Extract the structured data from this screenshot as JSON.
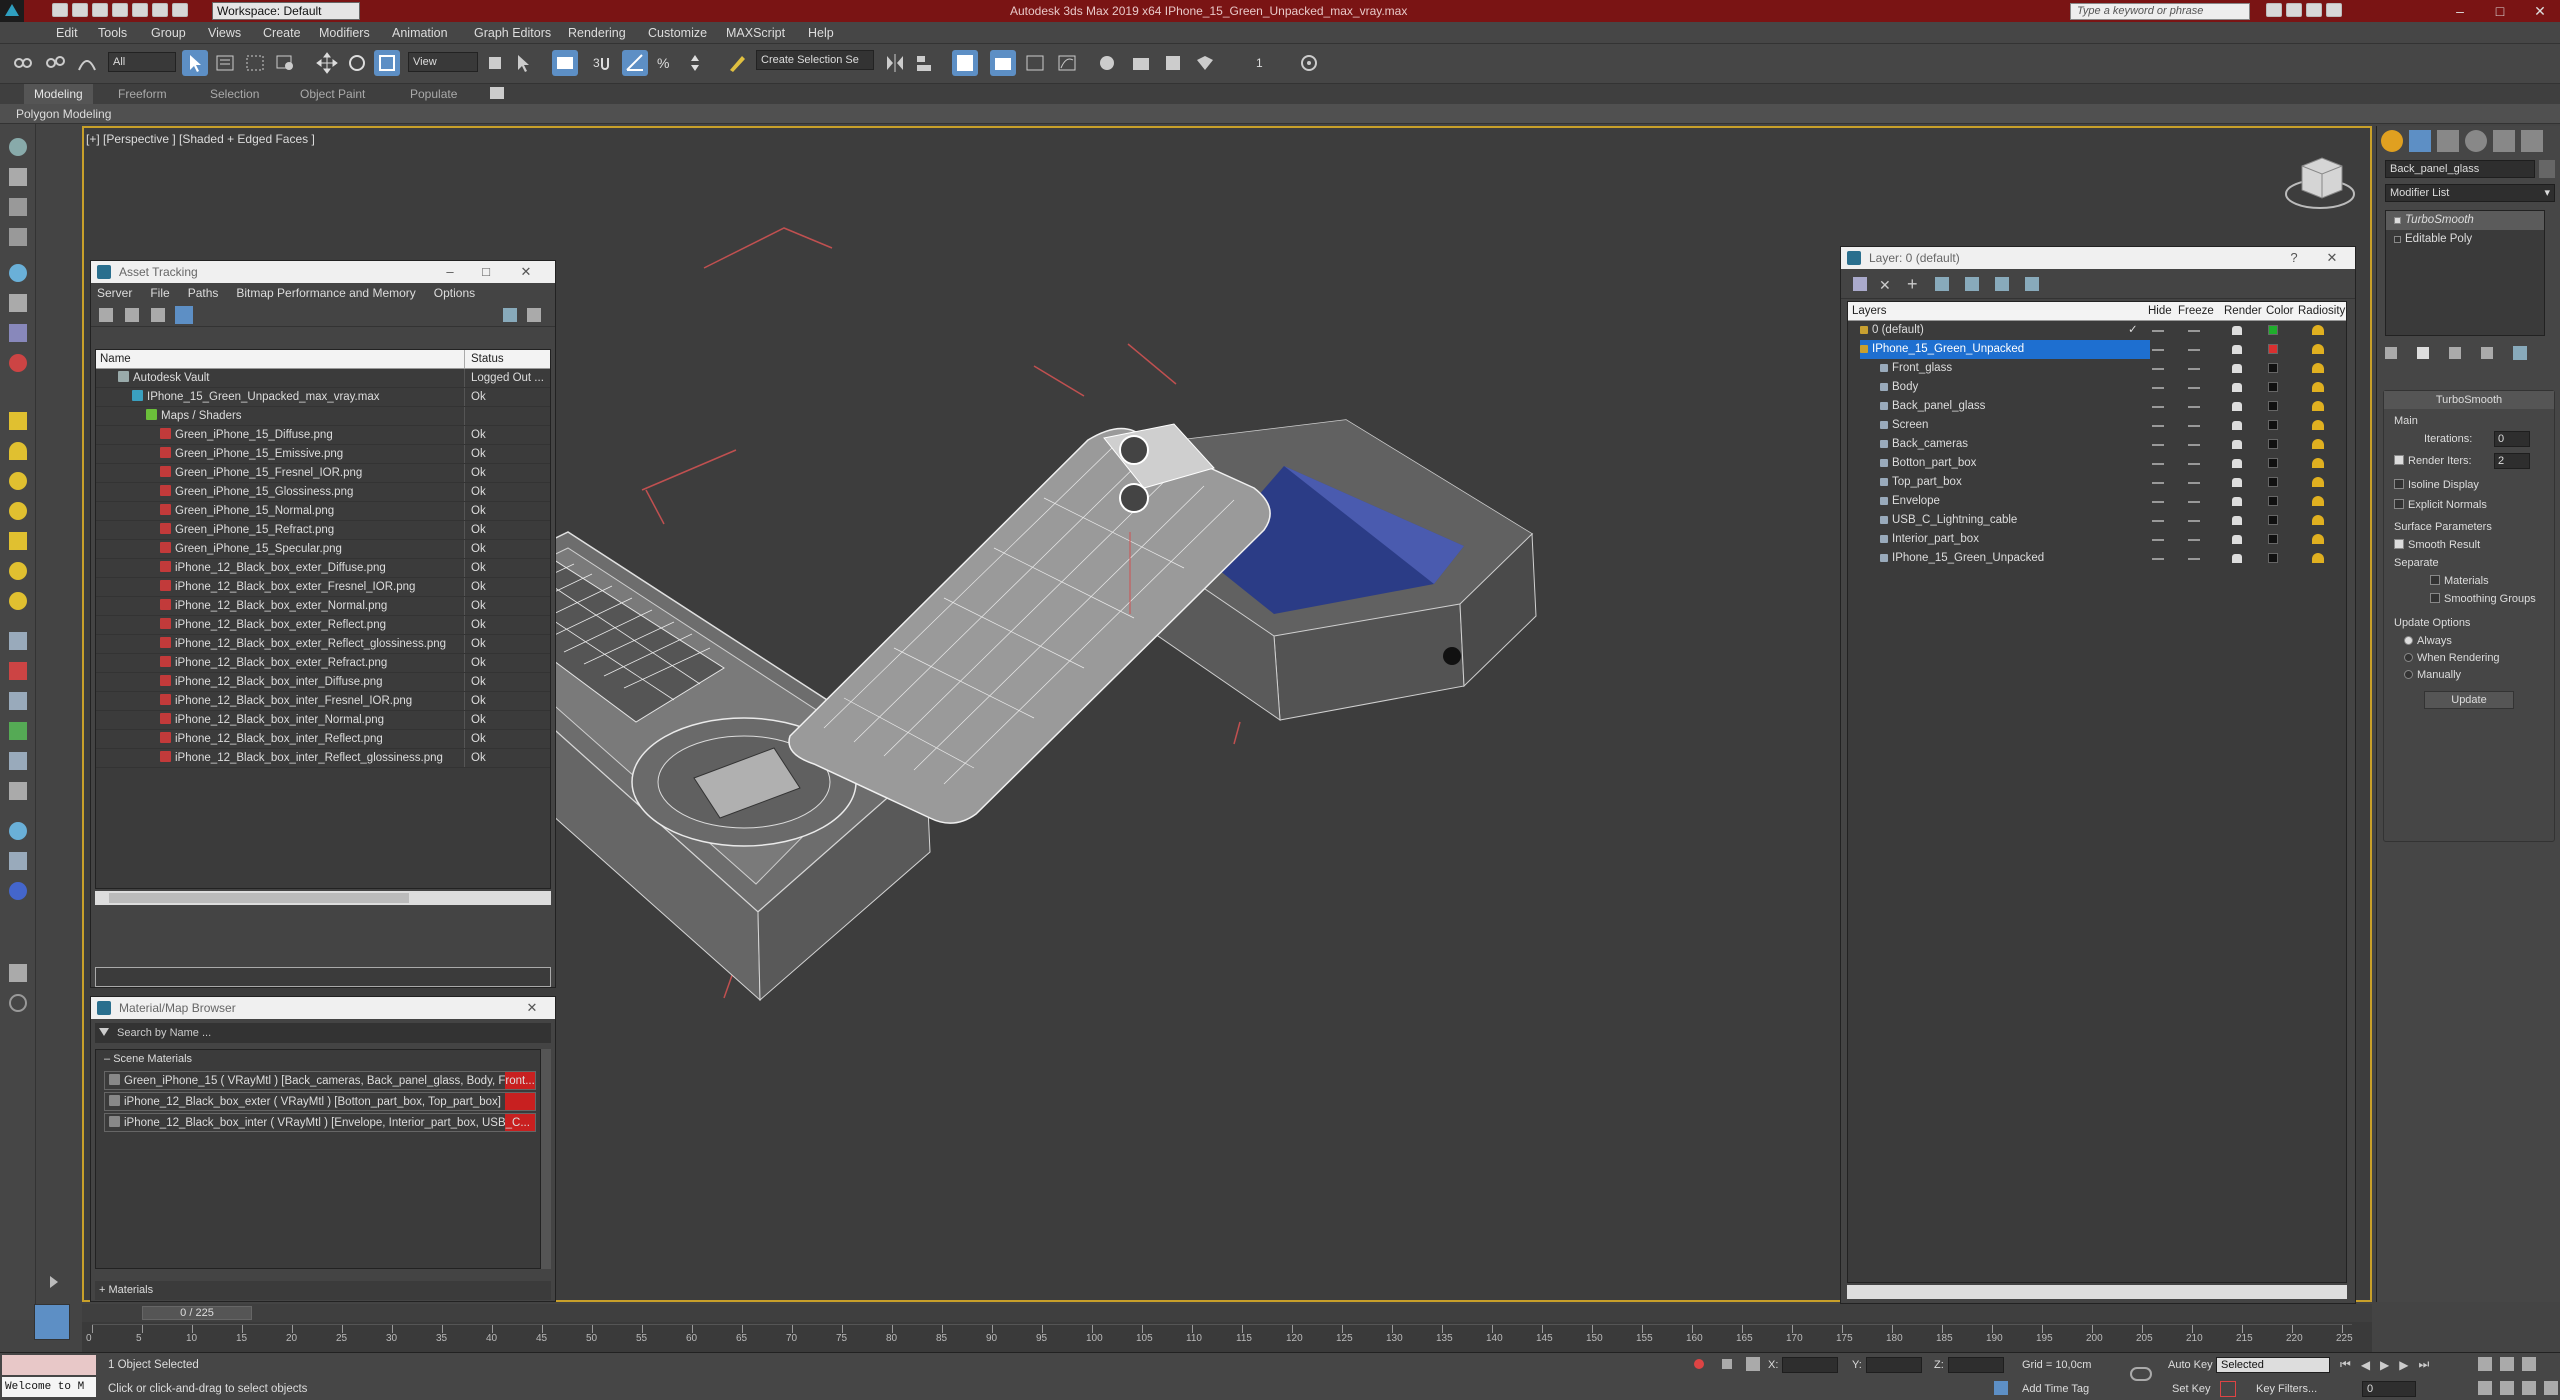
{
  "app": {
    "title": "Autodesk 3ds Max  2019 x64      IPhone_15_Green_Unpacked_max_vray.max",
    "workspace": "Workspace: Default",
    "search_placeholder": "Type a keyword or phrase"
  },
  "menu": [
    "Edit",
    "Tools",
    "Group",
    "Views",
    "Create",
    "Modifiers",
    "Animation",
    "Graph Editors",
    "Rendering",
    "Customize",
    "MAXScript",
    "Help"
  ],
  "toolbar": {
    "selection_filter": "All",
    "ref_coord": "View",
    "named_selection": "Create Selection Se",
    "snap_label": "3",
    "spinner_value": "1"
  },
  "ribbon": {
    "tabs": [
      "Modeling",
      "Freeform",
      "Selection",
      "Object Paint",
      "Populate"
    ],
    "active": "Modeling",
    "subtitle": "Polygon Modeling"
  },
  "viewport": {
    "label": "[+] [Perspective ] [Shaded + Edged Faces ]"
  },
  "asset_tracking": {
    "title": "Asset Tracking",
    "menu": [
      "Server",
      "File",
      "Paths",
      "Bitmap Performance and Memory",
      "Options"
    ],
    "col_name": "Name",
    "col_status": "Status",
    "rows": [
      {
        "name": "Autodesk Vault",
        "status": "Logged Out ...",
        "indent": 1,
        "icon": "vault"
      },
      {
        "name": "IPhone_15_Green_Unpacked_max_vray.max",
        "status": "Ok",
        "indent": 2,
        "icon": "max"
      },
      {
        "name": "Maps / Shaders",
        "status": "",
        "indent": 3,
        "icon": "maps"
      },
      {
        "name": "Green_iPhone_15_Diffuse.png",
        "status": "Ok",
        "indent": 4,
        "icon": "png"
      },
      {
        "name": "Green_iPhone_15_Emissive.png",
        "status": "Ok",
        "indent": 4,
        "icon": "png"
      },
      {
        "name": "Green_iPhone_15_Fresnel_IOR.png",
        "status": "Ok",
        "indent": 4,
        "icon": "png"
      },
      {
        "name": "Green_iPhone_15_Glossiness.png",
        "status": "Ok",
        "indent": 4,
        "icon": "png"
      },
      {
        "name": "Green_iPhone_15_Normal.png",
        "status": "Ok",
        "indent": 4,
        "icon": "png"
      },
      {
        "name": "Green_iPhone_15_Refract.png",
        "status": "Ok",
        "indent": 4,
        "icon": "png"
      },
      {
        "name": "Green_iPhone_15_Specular.png",
        "status": "Ok",
        "indent": 4,
        "icon": "png"
      },
      {
        "name": "iPhone_12_Black_box_exter_Diffuse.png",
        "status": "Ok",
        "indent": 4,
        "icon": "png"
      },
      {
        "name": "iPhone_12_Black_box_exter_Fresnel_IOR.png",
        "status": "Ok",
        "indent": 4,
        "icon": "png"
      },
      {
        "name": "iPhone_12_Black_box_exter_Normal.png",
        "status": "Ok",
        "indent": 4,
        "icon": "png"
      },
      {
        "name": "iPhone_12_Black_box_exter_Reflect.png",
        "status": "Ok",
        "indent": 4,
        "icon": "png"
      },
      {
        "name": "iPhone_12_Black_box_exter_Reflect_glossiness.png",
        "status": "Ok",
        "indent": 4,
        "icon": "png"
      },
      {
        "name": "iPhone_12_Black_box_exter_Refract.png",
        "status": "Ok",
        "indent": 4,
        "icon": "png"
      },
      {
        "name": "iPhone_12_Black_box_inter_Diffuse.png",
        "status": "Ok",
        "indent": 4,
        "icon": "png"
      },
      {
        "name": "iPhone_12_Black_box_inter_Fresnel_IOR.png",
        "status": "Ok",
        "indent": 4,
        "icon": "png"
      },
      {
        "name": "iPhone_12_Black_box_inter_Normal.png",
        "status": "Ok",
        "indent": 4,
        "icon": "png"
      },
      {
        "name": "iPhone_12_Black_box_inter_Reflect.png",
        "status": "Ok",
        "indent": 4,
        "icon": "png"
      },
      {
        "name": "iPhone_12_Black_box_inter_Reflect_glossiness.png",
        "status": "Ok",
        "indent": 4,
        "icon": "png"
      }
    ]
  },
  "material_browser": {
    "title": "Material/Map Browser",
    "search_placeholder": "Search by Name ...",
    "section": "Scene Materials",
    "items": [
      "Green_iPhone_15 ( VRayMtl ) [Back_cameras, Back_panel_glass, Body, Front...",
      "iPhone_12_Black_box_exter ( VRayMtl ) [Botton_part_box, Top_part_box]",
      "iPhone_12_Black_box_inter ( VRayMtl ) [Envelope, Interior_part_box, USB_C..."
    ],
    "footer": "+ Materials"
  },
  "layer_explorer": {
    "title": "Layer: 0 (default)",
    "columns": [
      "Layers",
      "Hide",
      "Freeze",
      "Render",
      "Color",
      "Radiosity"
    ],
    "rows": [
      {
        "name": "0 (default)",
        "level": 0,
        "color": "#1fae2c",
        "selected": false,
        "check": true
      },
      {
        "name": "IPhone_15_Green_Unpacked",
        "level": 0,
        "color": "#d83030",
        "selected": true,
        "check": false
      },
      {
        "name": "Front_glass",
        "level": 1,
        "color": "#101010",
        "selected": false,
        "check": false
      },
      {
        "name": "Body",
        "level": 1,
        "color": "#101010",
        "selected": false,
        "check": false
      },
      {
        "name": "Back_panel_glass",
        "level": 1,
        "color": "#101010",
        "selected": false,
        "check": false
      },
      {
        "name": "Screen",
        "level": 1,
        "color": "#101010",
        "selected": false,
        "check": false
      },
      {
        "name": "Back_cameras",
        "level": 1,
        "color": "#101010",
        "selected": false,
        "check": false
      },
      {
        "name": "Botton_part_box",
        "level": 1,
        "color": "#101010",
        "selected": false,
        "check": false
      },
      {
        "name": "Top_part_box",
        "level": 1,
        "color": "#101010",
        "selected": false,
        "check": false
      },
      {
        "name": "Envelope",
        "level": 1,
        "color": "#101010",
        "selected": false,
        "check": false
      },
      {
        "name": "USB_C_Lightning_cable",
        "level": 1,
        "color": "#101010",
        "selected": false,
        "check": false
      },
      {
        "name": "Interior_part_box",
        "level": 1,
        "color": "#101010",
        "selected": false,
        "check": false
      },
      {
        "name": "IPhone_15_Green_Unpacked",
        "level": 1,
        "color": "#101010",
        "selected": false,
        "check": false
      }
    ]
  },
  "command_panel": {
    "object_name": "Back_panel_glass",
    "modifier_list": "Modifier List",
    "stack": [
      "TurboSmooth",
      "Editable Poly"
    ],
    "rollout": "TurboSmooth",
    "main": "Main",
    "iterations_label": "Iterations:",
    "iterations": "0",
    "render_iters_label": "Render Iters:",
    "render_iters": "2",
    "isoline": "Isoline Display",
    "explicit": "Explicit Normals",
    "surface": "Surface Parameters",
    "smooth_result": "Smooth Result",
    "separate": "Separate",
    "materials": "Materials",
    "smoothing_groups": "Smoothing Groups",
    "update_options": "Update Options",
    "always": "Always",
    "when_rendering": "When Rendering",
    "manually": "Manually",
    "update_btn": "Update"
  },
  "timeline": {
    "frame": "0 / 225",
    "ticks": [
      "0",
      "5",
      "10",
      "15",
      "20",
      "25",
      "30",
      "35",
      "40",
      "45",
      "50",
      "55",
      "60",
      "65",
      "70",
      "75",
      "80",
      "85",
      "90",
      "95",
      "100",
      "105",
      "110",
      "115",
      "120",
      "125",
      "130",
      "135",
      "140",
      "145",
      "150",
      "155",
      "160",
      "165",
      "170",
      "175",
      "180",
      "185",
      "190",
      "195",
      "200",
      "205",
      "210",
      "215",
      "220",
      "225"
    ]
  },
  "status": {
    "welcome": "Welcome to M",
    "selected": "1 Object Selected",
    "hint": "Click or click-and-drag to select objects",
    "x_label": "X:",
    "y_label": "Y:",
    "z_label": "Z:",
    "grid": "Grid = 10,0cm",
    "add_time_tag": "Add Time Tag",
    "auto_key": "Auto Key",
    "set_key": "Set Key",
    "key_mode": "Selected",
    "key_filters": "Key Filters...",
    "frame_field": "0"
  }
}
